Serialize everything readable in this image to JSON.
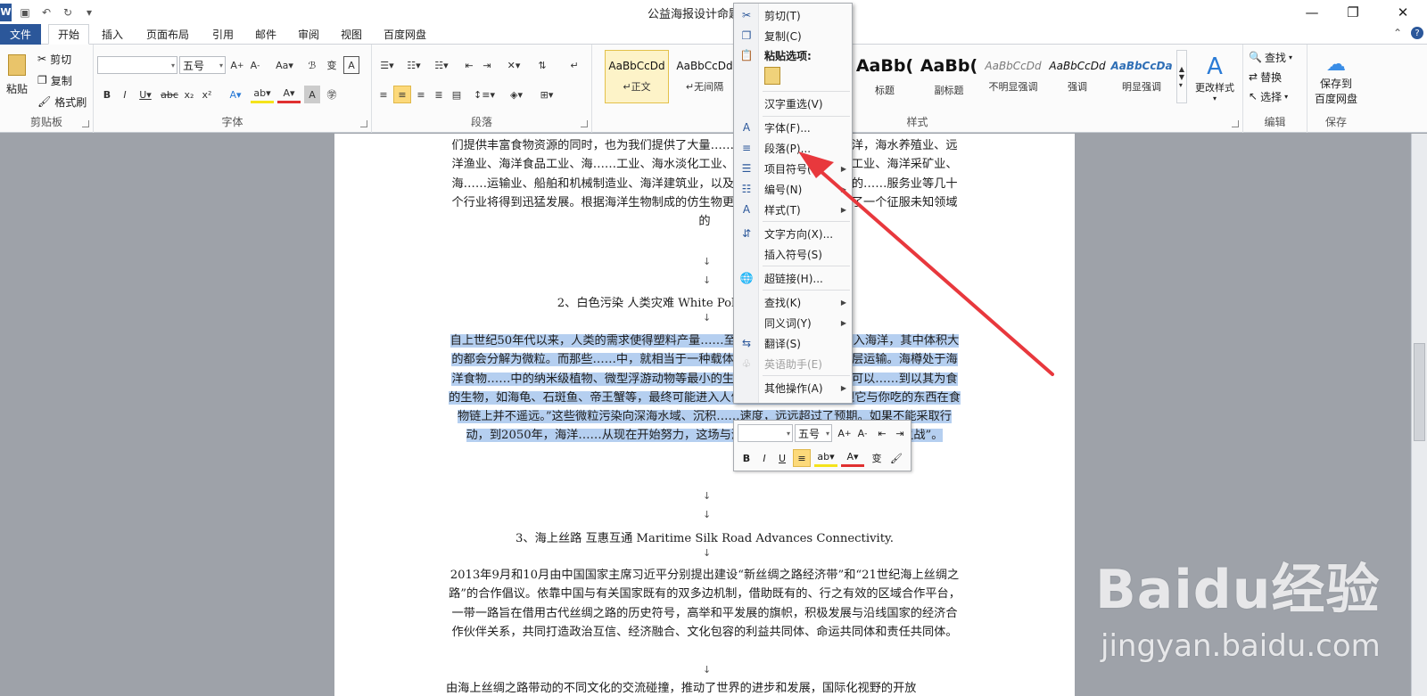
{
  "window": {
    "title": "公益海报设计命题.docx -"
  },
  "tabs": [
    "文件",
    "开始",
    "插入",
    "页面布局",
    "引用",
    "邮件",
    "审阅",
    "视图",
    "百度网盘"
  ],
  "clipboard": {
    "paste": "粘贴",
    "cut": "剪切",
    "copy": "复制",
    "format_painter": "格式刷",
    "label": "剪贴板"
  },
  "font": {
    "size": "五号",
    "label": "字体"
  },
  "paragraph": {
    "label": "段落"
  },
  "styles": {
    "label": "样式",
    "left": [
      {
        "preview": "AaBbCcDd",
        "name": "↵正文"
      },
      {
        "preview": "AaBbCcDd",
        "name": "↵无间隔"
      }
    ],
    "right": [
      {
        "preview": "AaBb(",
        "name": "标题"
      },
      {
        "preview": "AaBb(",
        "name": "副标题"
      },
      {
        "preview": "AaBbCcDd",
        "name": "不明显强调"
      },
      {
        "preview": "AaBbCcDd",
        "name": "强调"
      },
      {
        "preview": "AaBbCcDa",
        "name": "明显强调"
      }
    ],
    "change": "更改样式"
  },
  "editing": {
    "find": "查找",
    "replace": "替换",
    "select": "选择",
    "label": "编辑"
  },
  "save": {
    "line1": "保存到",
    "line2": "百度网盘",
    "label": "保存"
  },
  "context_menu": [
    {
      "label": "剪切(T)",
      "icon": "scissors-icon"
    },
    {
      "label": "复制(C)",
      "icon": "copy-icon"
    },
    {
      "label": "粘贴选项:",
      "icon": "paste-icon",
      "bold": true
    },
    {
      "label": "汉字重选(V)"
    },
    {
      "label": "字体(F)...",
      "icon": "font-icon"
    },
    {
      "label": "段落(P)...",
      "icon": "paragraph-icon"
    },
    {
      "label": "项目符号(B)",
      "icon": "bullets-icon",
      "submenu": true
    },
    {
      "label": "编号(N)",
      "icon": "numbering-icon",
      "submenu": true
    },
    {
      "label": "样式(T)",
      "icon": "styles-icon",
      "submenu": true
    },
    {
      "label": "文字方向(X)...",
      "icon": "text-direction-icon"
    },
    {
      "label": "插入符号(S)"
    },
    {
      "label": "超链接(H)...",
      "icon": "hyperlink-icon"
    },
    {
      "label": "查找(K)",
      "submenu": true
    },
    {
      "label": "同义词(Y)",
      "submenu": true
    },
    {
      "label": "翻译(S)",
      "icon": "translate-icon"
    },
    {
      "label": "英语助手(E)",
      "icon": "english-assistant-icon",
      "disabled": true
    },
    {
      "label": "其他操作(A)",
      "submenu": true
    }
  ],
  "mini_toolbar": {
    "size": "五号"
  },
  "document": {
    "p1": "们提供丰富食物资源的同时，也为我们提供了大量……世纪中国大规模开发海洋，海水养殖业、远洋渔业、海洋食品工业、海……工业、海水淡化工业、海洋能工业、海洋油气工业、海洋采矿业、海……运输业、船舶和机械制造业、海洋建筑业，以及围绕海洋产业发展起来的……服务业等几十个行业将得到迅猛发展。根据海洋生物制成的仿生物更是……海洋为人类提供了一个征服未知领域的",
    "h2": "2、白色污染 人类灾难 White Pollution……Humanity",
    "p2": "自上世纪50年代以来，人类的需求使得塑料产量……至今日已造成大量塑料涌入海洋，其中体积大的都会分解为微粒。而那些……中，就相当于一种载体，“负责”将塑料微粒层层运输。海樽处于海洋食物……中的纳米级植物、微型浮游动物等最小的生物为食。其体内的塑料可以……到以其为食的生物，如海龟、石斑鱼、帝王蟹等，最终可能进入人体。“没有人吃海樽，但它与你吃的东西在食物链上并不遥远。”这些微粒污染向深海水域、沉积……速度，远远超过了预期。如果不能采取行动，到2050年，海洋……从现在开始努力，这场与海洋塑料污染的抗衡也将是“世纪之战”。",
    "h3": "3、海上丝路 互惠互通 Maritime Silk Road Advances Connectivity.",
    "p3": "2013年9月和10月由中国国家主席习近平分别提出建设“新丝绸之路经济带”和“21世纪海上丝绸之路”的合作倡议。依靠中国与有关国家既有的双多边机制，借助既有的、行之有效的区域合作平台，一带一路旨在借用古代丝绸之路的历史符号，高举和平发展的旗帜，积极发展与沿线国家的经济合作伙伴关系，共同打造政治互信、经济融合、文化包容的利益共同体、命运共同体和责任共同体。",
    "p4": "由海上丝绸之路带动的不同文化的交流碰撞，推动了世界的进步和发展，国际化视野的开放"
  },
  "watermark": {
    "logo": "Baidu经验",
    "url": "jingyan.baidu.com"
  },
  "colors": {
    "accent": "#2b579a",
    "selection": "#b5cff0",
    "arrow": "#e8383d"
  }
}
